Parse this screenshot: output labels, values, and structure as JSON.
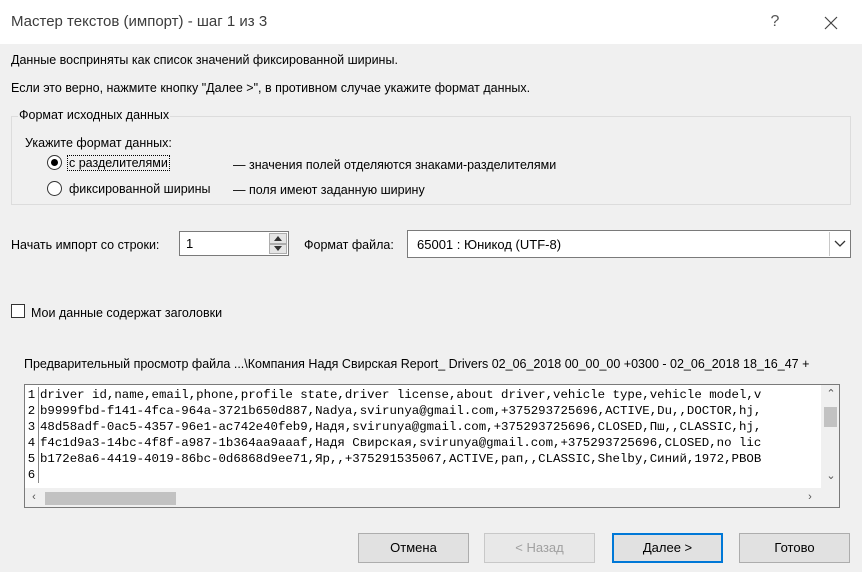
{
  "window": {
    "title": "Мастер текстов (импорт) - шаг 1 из 3",
    "help_label": "?"
  },
  "intro": {
    "line1": "Данные восприняты как список значений фиксированной ширины.",
    "line2": "Если это верно, нажмите кнопку \"Далее >\", в противном случае укажите формат данных."
  },
  "format_group": {
    "title": "Формат исходных данных",
    "prompt": "Укажите формат данных:",
    "options": [
      {
        "label": "с разделителями",
        "description": "— значения полей отделяются знаками-разделителями",
        "selected": true
      },
      {
        "label": "фиксированной ширины",
        "description": "— поля имеют заданную ширину",
        "selected": false
      }
    ]
  },
  "start_row": {
    "label": "Начать импорт со строки:",
    "value": "1"
  },
  "file_format": {
    "label": "Формат файла:",
    "value": "65001 : Юникод (UTF-8)"
  },
  "headers_checkbox": {
    "label": "Мои данные содержат заголовки",
    "checked": false
  },
  "preview": {
    "label": "Предварительный просмотр файла ...\\Компания Надя Свирская Report_ Drivers 02_06_2018 00_00_00 +0300 - 02_06_2018 18_16_47 +",
    "rows": [
      {
        "num": "1",
        "text": "driver id,name,email,phone,profile state,driver license,about driver,vehicle type,vehicle model,v"
      },
      {
        "num": "2",
        "text": "b9999fbd-f141-4fca-964a-3721b650d887,Nadya,svirunya@gmail.com,+375293725696,ACTIVE,Du,,DOCTOR,hj,"
      },
      {
        "num": "3",
        "text": "48d58adf-0ac5-4357-96e1-ac742e40feb9,Надя,svirunya@gmail.com,+375293725696,CLOSED,Пш,,CLASSIC,hj,"
      },
      {
        "num": "4",
        "text": "f4c1d9a3-14bc-4f8f-a987-1b364aa9aaaf,Надя Свирская,svirunya@gmail.com,+375293725696,CLOSED,no lic"
      },
      {
        "num": "5",
        "text": "b172e8a6-4419-4019-86bc-0d6868d9ee71,Яр,,+375291535067,ACTIVE,рап,,CLASSIC,Shelby,Синий,1972,PBOB"
      },
      {
        "num": "6",
        "text": ""
      }
    ]
  },
  "buttons": {
    "cancel": "Отмена",
    "back": "< Назад",
    "next": "Далее >",
    "finish": "Готово"
  },
  "colors": {
    "accent": "#0078d7",
    "dialog_bg": "#f0f0f0"
  }
}
